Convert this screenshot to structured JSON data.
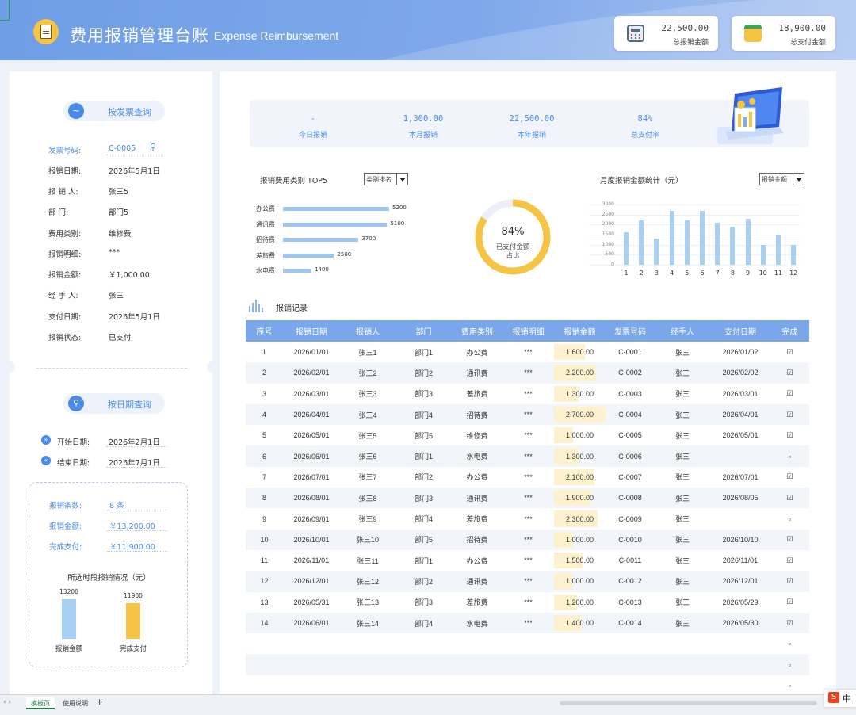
{
  "header": {
    "title_cn": "费用报销管理台账",
    "title_en": "Expense Reimbursement",
    "cards": [
      {
        "value": "22,500.00",
        "label": "总报销金额",
        "icon": "calculator-icon"
      },
      {
        "value": "18,900.00",
        "label": "总支付金额",
        "icon": "wallet-icon"
      }
    ]
  },
  "invoice_query": {
    "title": "按发票查询",
    "fields": [
      {
        "label": "发票号码:",
        "value": "C-0005"
      },
      {
        "label": "报销日期:",
        "value": "2026年5月1日"
      },
      {
        "label": "报 销 人:",
        "value": "张三5"
      },
      {
        "label": "部    门:",
        "value": "部门5"
      },
      {
        "label": "费用类别:",
        "value": "维修费"
      },
      {
        "label": "报销明细:",
        "value": "***"
      },
      {
        "label": "报销金额:",
        "value": "￥1,000.00"
      },
      {
        "label": "经 手 人:",
        "value": "张三"
      },
      {
        "label": "支付日期:",
        "value": "2026年5月1日"
      },
      {
        "label": "报销状态:",
        "value": "已支付"
      }
    ]
  },
  "date_query": {
    "title": "按日期查询",
    "start_label": "开始日期:",
    "start_value": "2026年2月1日",
    "end_label": "结束日期:",
    "end_value": "2026年7月1日"
  },
  "summary": {
    "count_label": "报销条数:",
    "count_value": "8 条",
    "amount_label": "报销金额:",
    "amount_value": "￥13,200.00",
    "paid_label": "完成支付:",
    "paid_value": "￥11,900.00",
    "chart_title": "所选时段报销情况（元）",
    "bars": [
      {
        "label": "报销金额",
        "value": 13200,
        "value_text": "13200",
        "color": "#a7d0f3"
      },
      {
        "label": "完成支付",
        "value": 11900,
        "value_text": "11900",
        "color": "#f6c444"
      }
    ]
  },
  "kpis": [
    {
      "value": "-",
      "label": "今日报销"
    },
    {
      "value": "1,300.00",
      "label": "本月报销"
    },
    {
      "value": "22,500.00",
      "label": "本年报销"
    },
    {
      "value": "84%",
      "label": "总支付率"
    }
  ],
  "top5": {
    "title": "报销费用类别 TOP5",
    "dropdown": "类别排名",
    "items": [
      {
        "label": "办公费",
        "value": 5200
      },
      {
        "label": "通讯费",
        "value": 5100
      },
      {
        "label": "招待费",
        "value": 3700
      },
      {
        "label": "差旅费",
        "value": 2500
      },
      {
        "label": "水电费",
        "value": 1400
      }
    ]
  },
  "donut": {
    "percent": "84%",
    "fraction": 0.84,
    "line1": "已支付金额",
    "line2": "占比",
    "color": "#f6c444",
    "track": "#eceff8"
  },
  "monthly": {
    "title": "月度报销金额统计（元）",
    "dropdown": "报销金额"
  },
  "records_title": "报销记录",
  "table": {
    "headers": [
      "序号",
      "报销日期",
      "报销人",
      "部门",
      "费用类别",
      "报销明细",
      "报销金额",
      "发票号码",
      "经手人",
      "支付日期",
      "完成"
    ],
    "rows": [
      [
        "1",
        "2026/01/01",
        "张三1",
        "部门1",
        "办公费",
        "***",
        "1,600.00",
        "C-0001",
        "张三",
        "2026/01/02",
        "☑"
      ],
      [
        "2",
        "2026/02/01",
        "张三2",
        "部门2",
        "通讯费",
        "***",
        "2,200.00",
        "C-0002",
        "张三",
        "2026/02/02",
        "☑"
      ],
      [
        "3",
        "2026/03/01",
        "张三3",
        "部门3",
        "差旅费",
        "***",
        "1,300.00",
        "C-0003",
        "张三",
        "2026/03/01",
        "☑"
      ],
      [
        "4",
        "2026/04/01",
        "张三4",
        "部门4",
        "招待费",
        "***",
        "2,700.00",
        "C-0004",
        "张三",
        "2026/04/01",
        "☑"
      ],
      [
        "5",
        "2026/05/01",
        "张三5",
        "部门5",
        "维修费",
        "***",
        "1,000.00",
        "C-0005",
        "张三",
        "2026/05/01",
        "☑"
      ],
      [
        "6",
        "2026/06/01",
        "张三6",
        "部门1",
        "水电费",
        "***",
        "1,300.00",
        "C-0006",
        "张三",
        "",
        "▫"
      ],
      [
        "7",
        "2026/07/01",
        "张三7",
        "部门2",
        "办公费",
        "***",
        "2,100.00",
        "C-0007",
        "张三",
        "2026/07/01",
        "☑"
      ],
      [
        "8",
        "2026/08/01",
        "张三8",
        "部门3",
        "通讯费",
        "***",
        "1,900.00",
        "C-0008",
        "张三",
        "2026/08/05",
        "☑"
      ],
      [
        "9",
        "2026/09/01",
        "张三9",
        "部门4",
        "差旅费",
        "***",
        "2,300.00",
        "C-0009",
        "张三",
        "",
        "▫"
      ],
      [
        "10",
        "2026/10/01",
        "张三10",
        "部门5",
        "招待费",
        "***",
        "1,000.00",
        "C-0010",
        "张三",
        "2026/10/10",
        "☑"
      ],
      [
        "11",
        "2026/11/01",
        "张三11",
        "部门1",
        "办公费",
        "***",
        "1,500.00",
        "C-0011",
        "张三",
        "2026/11/01",
        "☑"
      ],
      [
        "12",
        "2026/12/01",
        "张三12",
        "部门2",
        "通讯费",
        "***",
        "1,000.00",
        "C-0012",
        "张三",
        "2026/12/01",
        "☑"
      ],
      [
        "13",
        "2026/05/31",
        "张三13",
        "部门3",
        "差旅费",
        "***",
        "1,200.00",
        "C-0013",
        "张三",
        "2026/05/29",
        "☑"
      ],
      [
        "14",
        "2026/06/01",
        "张三14",
        "部门4",
        "水电费",
        "***",
        "1,400.00",
        "C-0014",
        "张三",
        "2026/05/30",
        "☑"
      ],
      [
        "",
        "",
        "",
        "",
        "",
        "",
        "",
        "",
        "",
        "",
        "▫"
      ],
      [
        "",
        "",
        "",
        "",
        "",
        "",
        "",
        "",
        "",
        "",
        "▫"
      ],
      [
        "",
        "",
        "",
        "",
        "",
        "",
        "",
        "",
        "",
        "",
        "▫"
      ]
    ]
  },
  "sheets": {
    "tabs": [
      "模板页",
      "使用说明"
    ],
    "add": "+",
    "nav": "‹ ›"
  },
  "ime": {
    "logo": "S",
    "text": "中"
  },
  "chart_data": [
    {
      "type": "bar",
      "orientation": "horizontal",
      "title": "报销费用类别 TOP5",
      "categories": [
        "办公费",
        "通讯费",
        "招待费",
        "差旅费",
        "水电费"
      ],
      "values": [
        5200,
        5100,
        3700,
        2500,
        1400
      ]
    },
    {
      "type": "pie",
      "title": "",
      "labels": [
        "已支付金额占比",
        ""
      ],
      "values": [
        84,
        16
      ]
    },
    {
      "type": "bar",
      "title": "月度报销金额统计（元）",
      "categories": [
        "1",
        "2",
        "3",
        "4",
        "5",
        "6",
        "7",
        "8",
        "9",
        "10",
        "11",
        "12"
      ],
      "values": [
        1600,
        2200,
        1300,
        2700,
        2200,
        2700,
        2100,
        1900,
        2300,
        1000,
        1500,
        1000
      ],
      "ylim": [
        0,
        3000
      ],
      "yticks": [
        "3000",
        "2500",
        "2000",
        "1500",
        "1000",
        "500",
        "0"
      ]
    }
  ]
}
